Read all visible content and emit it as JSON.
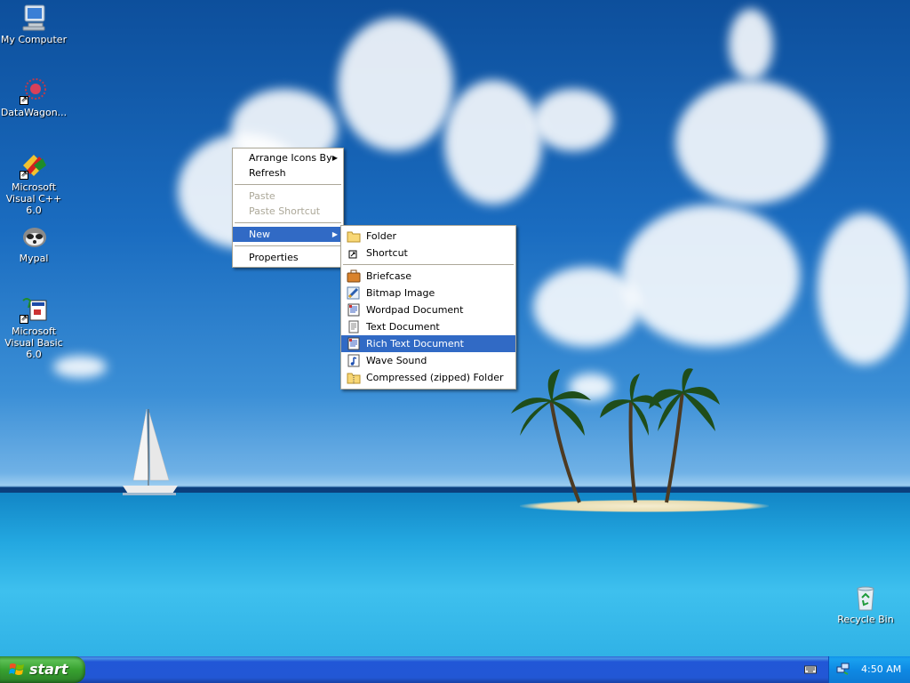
{
  "desktop": {
    "icons": [
      {
        "name": "my-computer",
        "label": "My Computer"
      },
      {
        "name": "datawagon",
        "label": "DataWagon..."
      },
      {
        "name": "msvc",
        "label": "Microsoft Visual C++ 6.0"
      },
      {
        "name": "mypal",
        "label": "Mypal"
      },
      {
        "name": "msvb",
        "label": "Microsoft Visual Basic 6.0"
      },
      {
        "name": "recycle-bin",
        "label": "Recycle Bin"
      }
    ]
  },
  "context_menu": {
    "items": [
      {
        "label": "Arrange Icons By",
        "submenu": true,
        "disabled": false
      },
      {
        "label": "Refresh",
        "disabled": false
      },
      {
        "label": "Paste",
        "disabled": true
      },
      {
        "label": "Paste Shortcut",
        "disabled": true
      },
      {
        "label": "New",
        "submenu": true,
        "highlighted": true
      },
      {
        "label": "Properties",
        "disabled": false
      }
    ]
  },
  "new_submenu": {
    "items": [
      {
        "label": "Folder",
        "icon": "folder-icon"
      },
      {
        "label": "Shortcut",
        "icon": "shortcut-icon"
      },
      {
        "label": "Briefcase",
        "icon": "briefcase-icon"
      },
      {
        "label": "Bitmap Image",
        "icon": "bitmap-icon"
      },
      {
        "label": "Wordpad Document",
        "icon": "wordpad-icon"
      },
      {
        "label": "Text Document",
        "icon": "text-document-icon"
      },
      {
        "label": "Rich Text Document",
        "icon": "rich-text-icon",
        "highlighted": true
      },
      {
        "label": "Wave Sound",
        "icon": "wave-sound-icon"
      },
      {
        "label": "Compressed (zipped) Folder",
        "icon": "zip-folder-icon"
      }
    ]
  },
  "taskbar": {
    "start_label": "start",
    "clock": "4:50 AM"
  },
  "colors": {
    "menu_highlight": "#316ac5",
    "taskbar_blue": "#2257d5",
    "start_green": "#38a130",
    "tray_blue": "#0e8ae4"
  }
}
